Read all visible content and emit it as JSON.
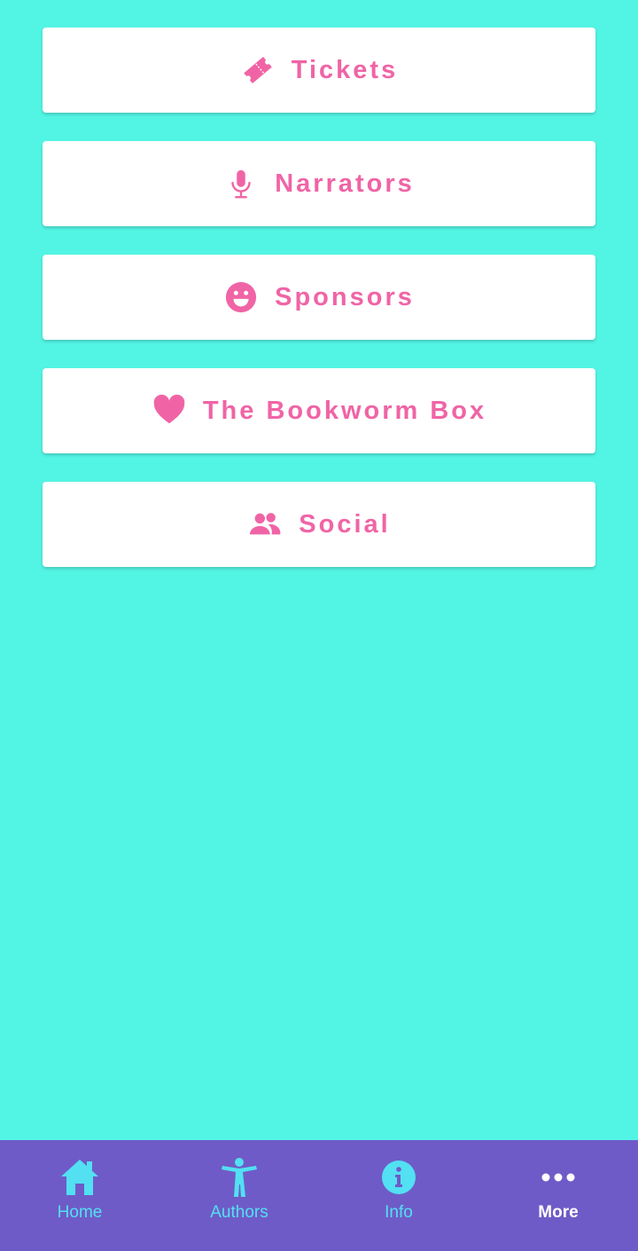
{
  "colors": {
    "background": "#52f4e4",
    "card": "#ffffff",
    "accent_pink": "#f064a6",
    "tabbar": "#6f5bc7",
    "tab_inactive": "#52e0f2",
    "tab_active": "#ffffff"
  },
  "menu": {
    "items": [
      {
        "label": "Tickets",
        "icon": "ticket-icon"
      },
      {
        "label": "Narrators",
        "icon": "microphone-icon"
      },
      {
        "label": "Sponsors",
        "icon": "smile-icon"
      },
      {
        "label": "The Bookworm Box",
        "icon": "heart-icon"
      },
      {
        "label": "Social",
        "icon": "users-icon"
      }
    ]
  },
  "tabbar": {
    "tabs": [
      {
        "label": "Home",
        "icon": "home-icon",
        "active": false
      },
      {
        "label": "Authors",
        "icon": "person-icon",
        "active": false
      },
      {
        "label": "Info",
        "icon": "info-icon",
        "active": false
      },
      {
        "label": "More",
        "icon": "more-icon",
        "active": true
      }
    ]
  }
}
